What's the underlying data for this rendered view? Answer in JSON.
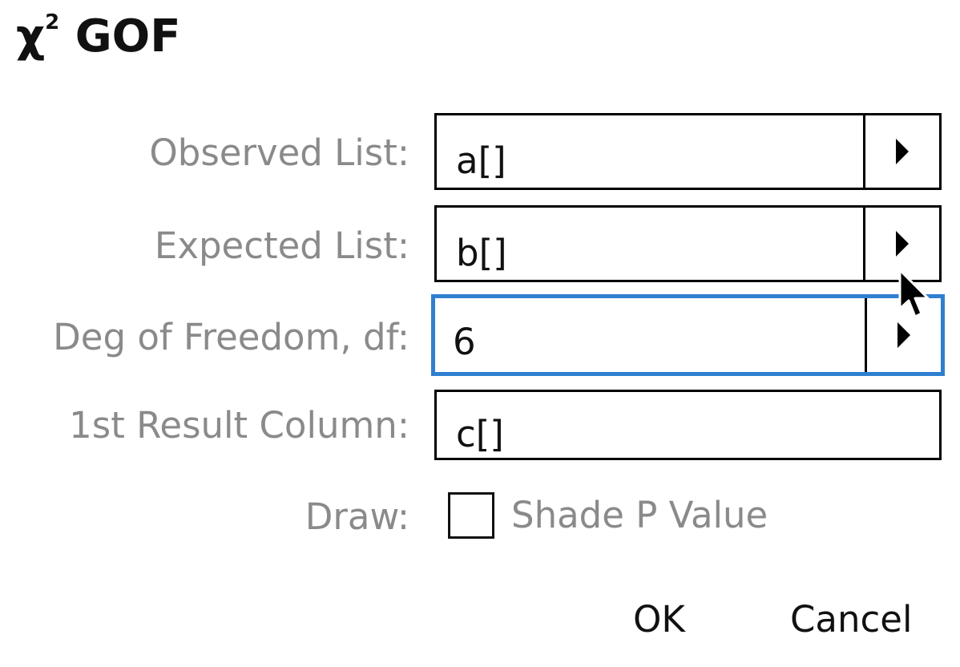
{
  "dialog": {
    "title_symbol": "χ",
    "title_superscript": "2",
    "title_text": "GOF"
  },
  "fields": [
    {
      "label": "Observed List:",
      "value": "a[]",
      "has_dropdown": true,
      "focused": false
    },
    {
      "label": "Expected List:",
      "value": "b[]",
      "has_dropdown": true,
      "focused": false
    },
    {
      "label": "Deg of Freedom, df:",
      "value": "6",
      "has_dropdown": true,
      "focused": true
    },
    {
      "label": "1st Result Column:",
      "value": "c[]",
      "has_dropdown": false,
      "focused": false
    }
  ],
  "draw": {
    "label": "Draw:",
    "checkbox_label": "Shade P Value",
    "checked": false
  },
  "buttons": {
    "ok": "OK",
    "cancel": "Cancel"
  },
  "colors": {
    "focus_border": "#2f7fd0",
    "label_text": "#8a8a8a",
    "field_border": "#000000"
  },
  "icons": {
    "dropdown": "triangle-right-icon",
    "pointer": "mouse-pointer-icon"
  }
}
